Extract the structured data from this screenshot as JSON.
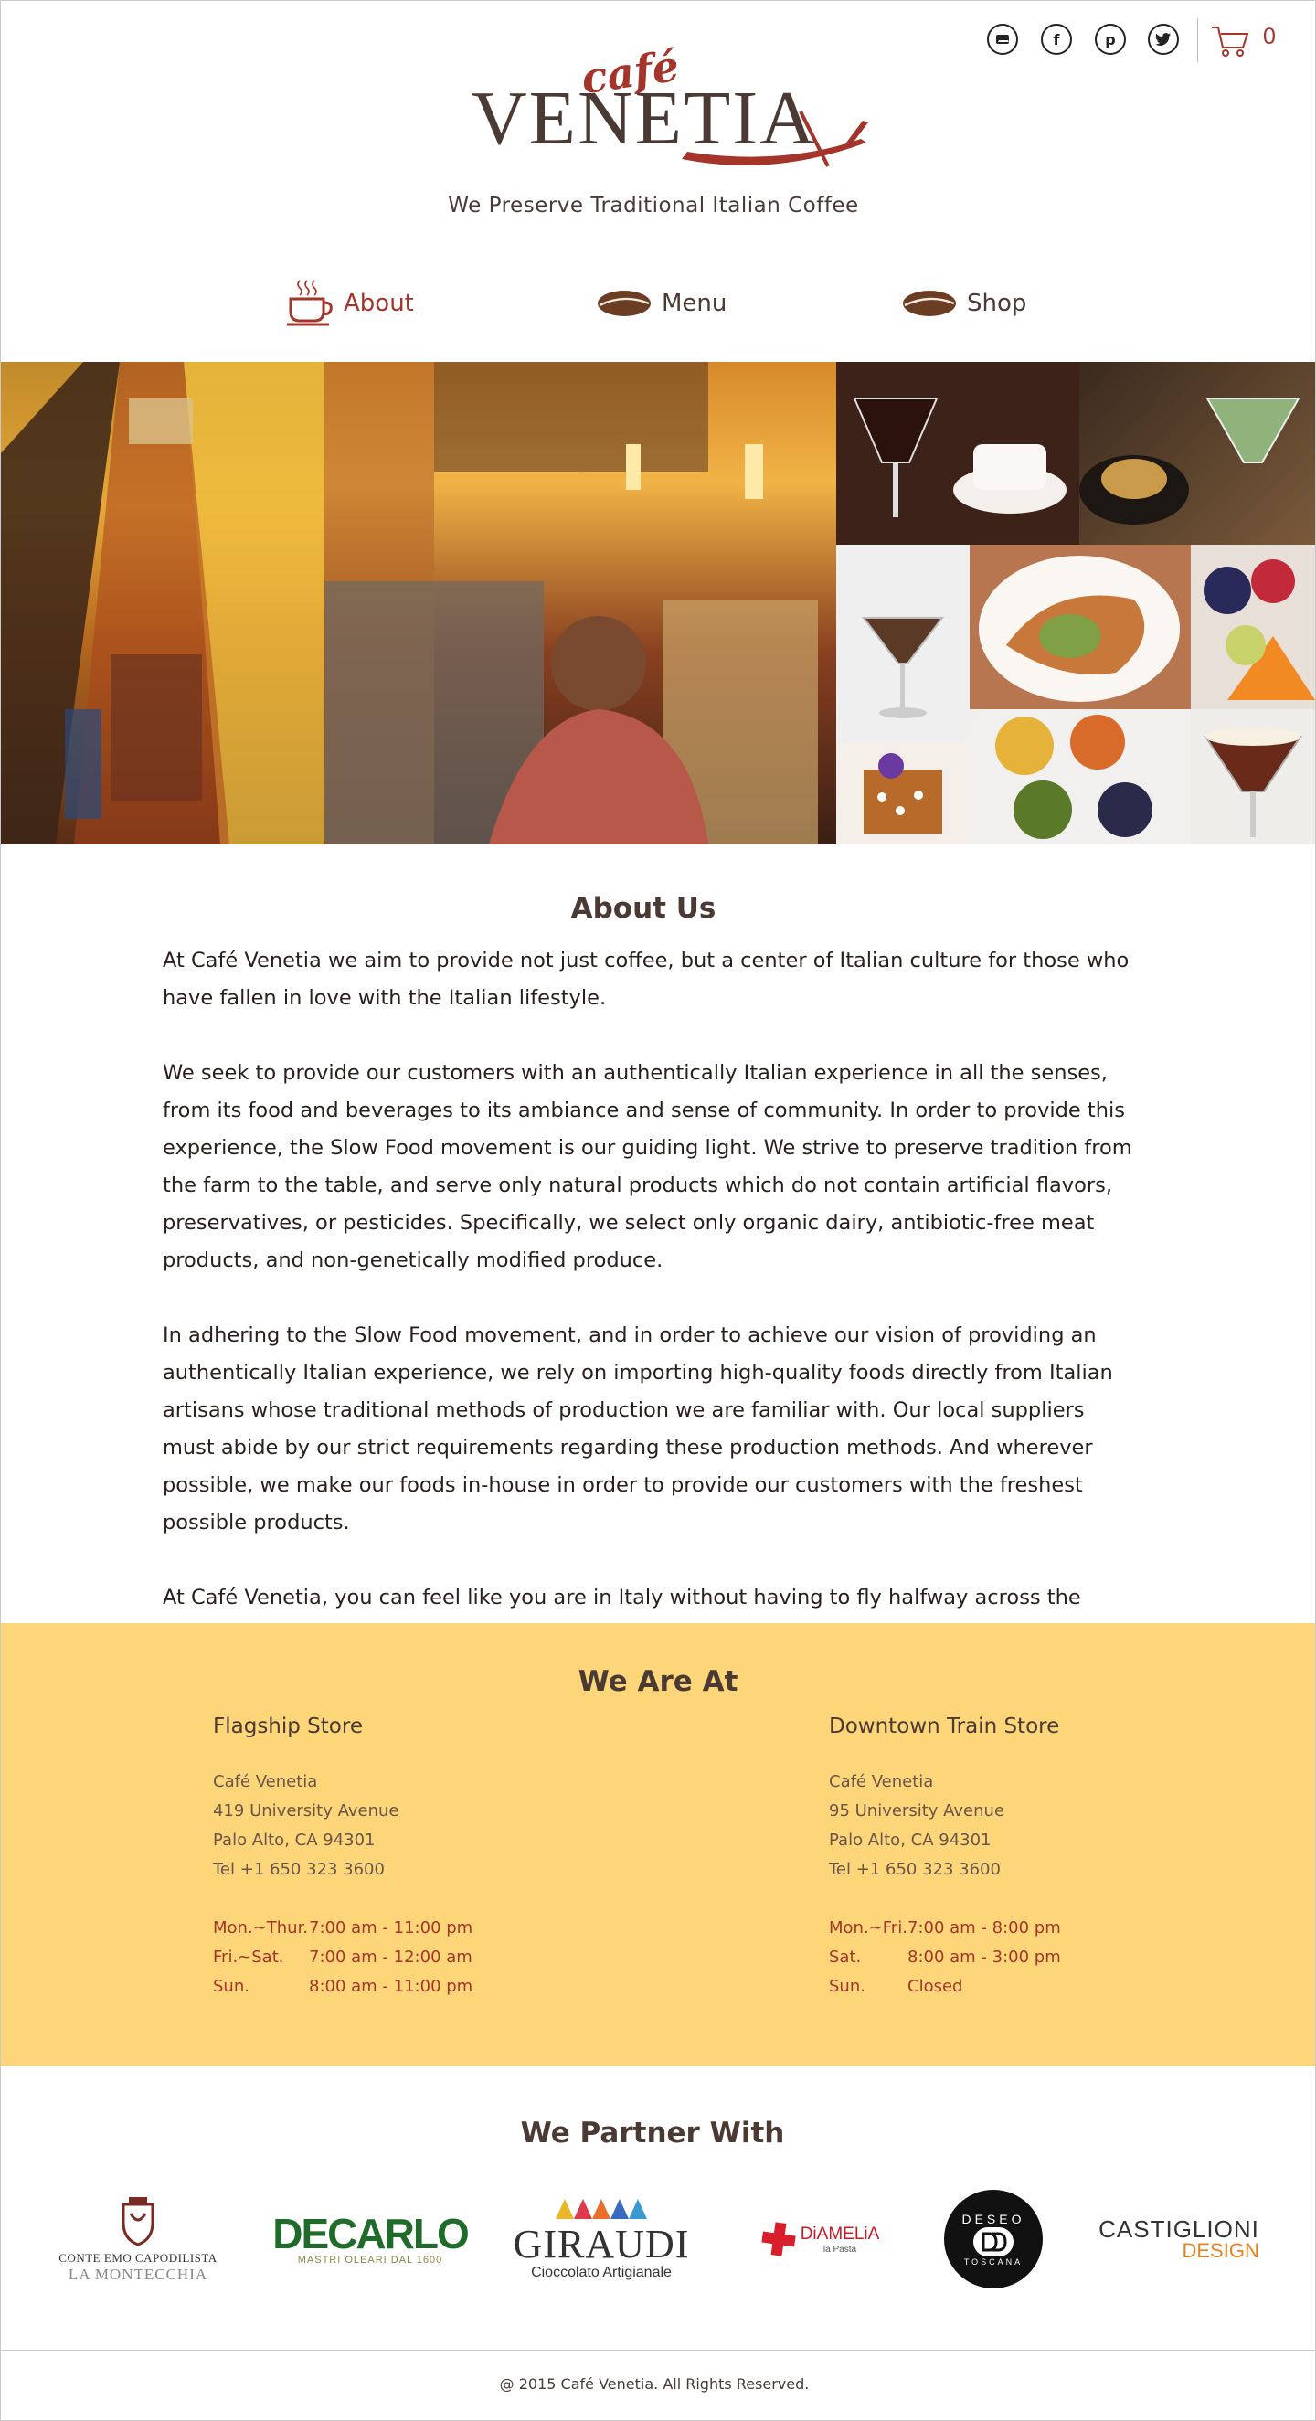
{
  "header": {
    "logo_small": "café",
    "logo_main": "VENETIA",
    "tagline": "We Preserve Traditional Italian Coffee",
    "cart_count": "0",
    "social": [
      "mail-icon",
      "facebook-icon",
      "pinterest-icon",
      "twitter-icon"
    ]
  },
  "nav": {
    "items": [
      {
        "label": "About"
      },
      {
        "label": "Menu"
      },
      {
        "label": "Shop"
      }
    ]
  },
  "about": {
    "title": "About Us",
    "paragraphs": [
      "At Café Venetia we aim to provide not just coffee, but a center of Italian culture for those who have fallen in love with the Italian lifestyle.",
      "We seek to provide our customers with an authentically Italian experience in all the senses, from its food and beverages to its ambiance and sense of community. In order to provide this experience, the Slow Food movement is our guiding light. We strive to preserve tradition from the farm to the table, and serve only natural products which do not contain artificial flavors, preservatives, or pesticides. Specifically, we select only organic dairy, antibiotic-free meat products, and non-genetically modified produce.",
      "In adhering to the Slow Food movement, and in order to achieve our vision of providing an authentically Italian experience, we rely on importing high-quality foods directly from Italian artisans whose traditional methods of production we are familiar with. Our local suppliers must abide by our strict requirements regarding these production methods. And wherever possible, we make our foods in-house in order to provide our customers with the freshest possible products.",
      "At Café Venetia, you can feel like you are in Italy without having to fly halfway across the world."
    ]
  },
  "locations": {
    "title": "We Are At",
    "stores": [
      {
        "name": "Flagship Store",
        "lines": [
          "Café Venetia",
          "419 University Avenue",
          "Palo Alto, CA 94301",
          "Tel +1 650 323 3600"
        ],
        "hours": [
          {
            "day": "Mon.~Thur.",
            "time": "7:00 am - 11:00 pm"
          },
          {
            "day": "Fri.~Sat.",
            "time": "7:00 am - 12:00 am"
          },
          {
            "day": "Sun.",
            "time": "8:00 am - 11:00 pm"
          }
        ]
      },
      {
        "name": "Downtown Train Store",
        "lines": [
          "Café Venetia",
          "95 University Avenue",
          "Palo Alto, CA 94301",
          "Tel +1 650 323 3600"
        ],
        "hours": [
          {
            "day": "Mon.~Fri.",
            "time": "7:00 am - 8:00 pm"
          },
          {
            "day": "Sat.",
            "time": "8:00 am - 3:00 pm"
          },
          {
            "day": "Sun.",
            "time": "Closed"
          }
        ]
      }
    ]
  },
  "partners": {
    "title": "We Partner With",
    "logos": [
      {
        "top": "CONTE EMO CAPODILISTA",
        "bottom": "LA MONTECCHIA"
      },
      {
        "top": "DECARLO",
        "bottom": "MASTRI OLEARI DAL 1600"
      },
      {
        "top": "GIRAUDI",
        "bottom": "Cioccolato Artigianale"
      },
      {
        "top": "DiAMELiA",
        "bottom": "la Pasta"
      },
      {
        "top": "DESEO",
        "bottom": "TOSCANA"
      },
      {
        "top": "CASTIGLIONI",
        "bottom": "DESIGN"
      }
    ]
  },
  "footer": {
    "copyright": "@ 2015 Café Venetia. All Rights Reserved."
  },
  "colors": {
    "accent": "#a5352a",
    "text_dark": "#4a3a33",
    "locations_bg": "#fdd67a"
  }
}
